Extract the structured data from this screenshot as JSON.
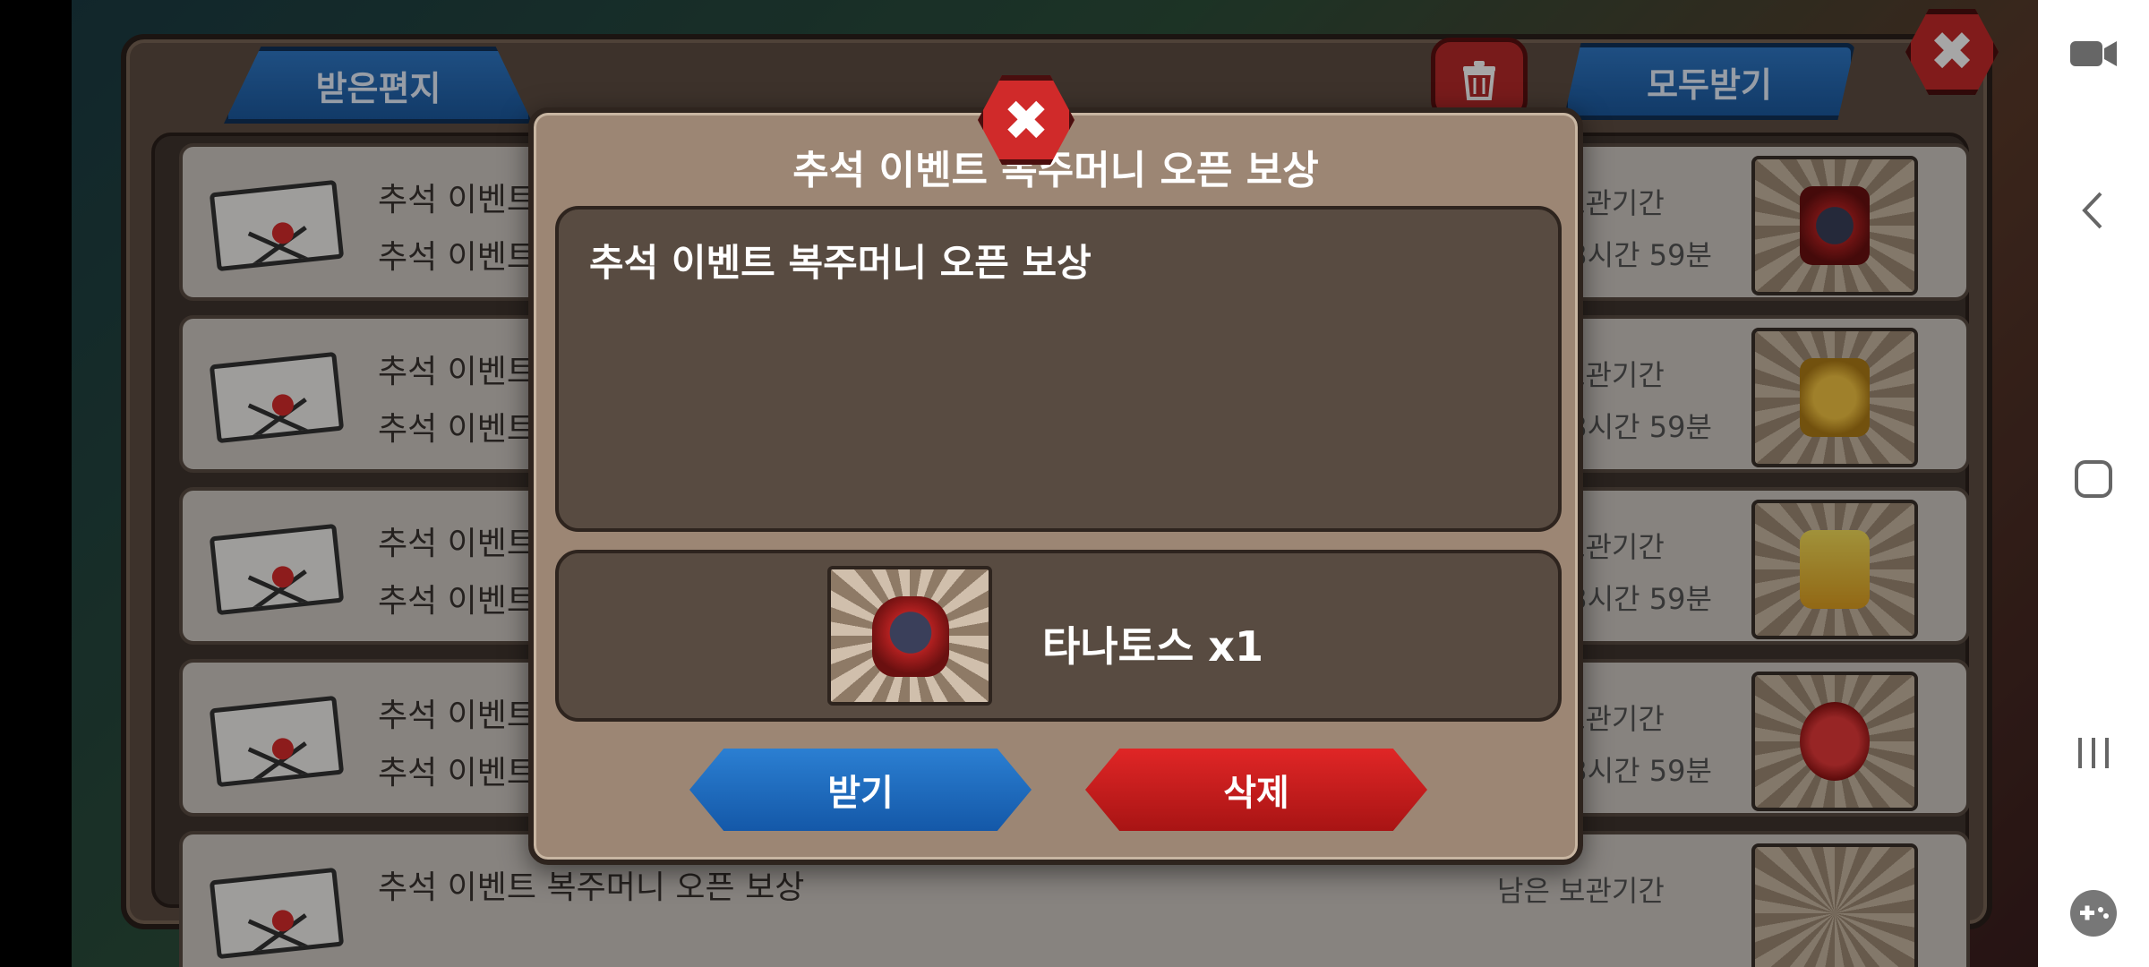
{
  "mailbox": {
    "tab_received": "받은편지",
    "receive_all": "모두받기",
    "close": "✖"
  },
  "mail_rows": [
    {
      "title": "추석 이벤트 복주머니 오픈 보상",
      "subtitle": "추석 이벤트 복주머니 오픈 보상",
      "storage_label": "남은 보관기간",
      "storage_time": "6일 23시간 59분",
      "item_icon": "thanatos-icon"
    },
    {
      "title": "추석 이벤트 복주머니 오픈 보상",
      "subtitle": "추석 이벤트 복주머니 오픈 보상",
      "storage_label": "남은 보관기간",
      "storage_time": "6일 23시간 59분",
      "item_icon": "gold-medal-icon"
    },
    {
      "title": "추석 이벤트 복주머니 오픈 보상",
      "subtitle": "추석 이벤트 복주머니 오픈 보상",
      "storage_label": "남은 보관기간",
      "storage_time": "6일 23시간 59분",
      "item_icon": "level-up-icon"
    },
    {
      "title": "추석 이벤트 복주머니 오픈 보상",
      "subtitle": "추석 이벤트 복주머니 오픈 보상",
      "storage_label": "남은 보관기간",
      "storage_time": "6일 23시간 59분",
      "item_icon": "red-potion-icon"
    },
    {
      "title": "추석 이벤트 복주머니 오픈 보상",
      "subtitle": "",
      "storage_label": "남은 보관기간",
      "storage_time": "",
      "item_icon": "potion-icon"
    }
  ],
  "modal": {
    "title": "추석 이벤트 복주머니 오픈 보상",
    "message": "추석 이벤트 복주머니 오픈 보상",
    "reward_name": "타나토스 x1",
    "reward_icon": "thanatos-icon",
    "claim_label": "받기",
    "delete_label": "삭제",
    "close": "✖"
  },
  "colors": {
    "blue_button": "#1c6ac0",
    "red_button": "#c81c1c"
  }
}
